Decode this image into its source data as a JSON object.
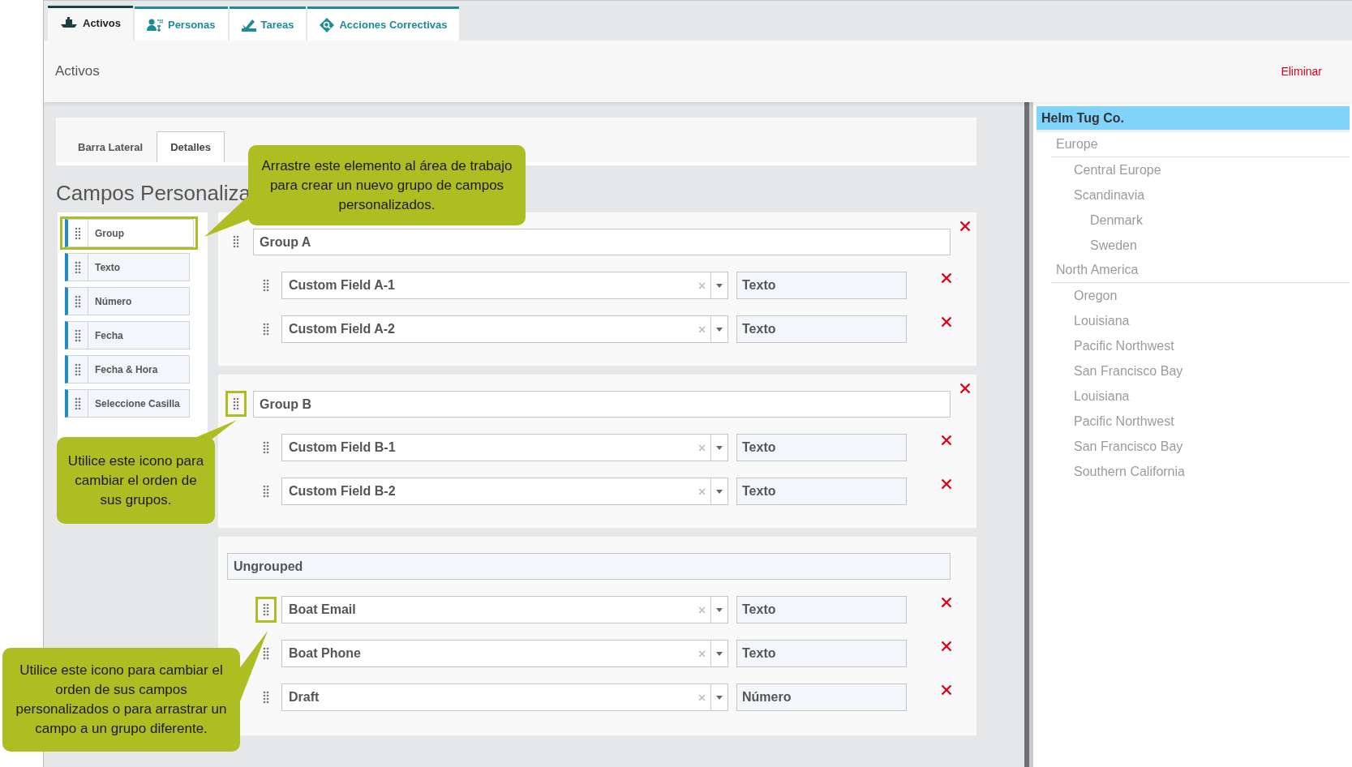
{
  "top_tabs": [
    {
      "label": "Activos",
      "selected": true
    },
    {
      "label": "Personas",
      "selected": false
    },
    {
      "label": "Tareas",
      "selected": false
    },
    {
      "label": "Acciones Correctivas",
      "selected": false
    }
  ],
  "header": {
    "title": "Activos",
    "action": "Eliminar"
  },
  "sub_tabs": [
    {
      "label": "Barra Lateral",
      "selected": false
    },
    {
      "label": "Detalles",
      "selected": true
    }
  ],
  "section_title": "Campos Personaliza",
  "palette": [
    {
      "label": "Group",
      "highlighted": true
    },
    {
      "label": "Texto",
      "highlighted": false
    },
    {
      "label": "Número",
      "highlighted": false
    },
    {
      "label": "Fecha",
      "highlighted": false
    },
    {
      "label": "Fecha & Hora",
      "highlighted": false
    },
    {
      "label": "Seleccione Casilla",
      "highlighted": false
    }
  ],
  "groups": [
    {
      "kind": "group",
      "name": "Group A",
      "highlighted": false,
      "fields": [
        {
          "name": "Custom Field A-1",
          "type": "Texto",
          "highlighted": false
        },
        {
          "name": "Custom Field A-2",
          "type": "Texto",
          "highlighted": false
        }
      ]
    },
    {
      "kind": "group",
      "name": "Group B",
      "highlighted": true,
      "fields": [
        {
          "name": "Custom Field B-1",
          "type": "Texto",
          "highlighted": false
        },
        {
          "name": "Custom Field B-2",
          "type": "Texto",
          "highlighted": false
        }
      ]
    },
    {
      "kind": "ungrouped",
      "name": "Ungrouped",
      "fields": [
        {
          "name": "Boat Email",
          "type": "Texto",
          "highlighted": true
        },
        {
          "name": "Boat Phone",
          "type": "Texto",
          "highlighted": false
        },
        {
          "name": "Draft",
          "type": "Número",
          "highlighted": false
        }
      ]
    }
  ],
  "tree": [
    {
      "label": "Helm Tug Co.",
      "selected": true,
      "children": [
        {
          "label": "Europe",
          "selected": false,
          "children": [
            {
              "label": "Central Europe",
              "selected": false
            },
            {
              "label": "Scandinavia",
              "selected": false,
              "children": [
                {
                  "label": "Denmark",
                  "selected": false
                },
                {
                  "label": "Sweden",
                  "selected": false
                }
              ]
            }
          ]
        },
        {
          "label": "North America",
          "selected": false,
          "children": [
            {
              "label": "Oregon",
              "selected": false
            },
            {
              "label": "Louisiana",
              "selected": false
            },
            {
              "label": "Pacific Northwest",
              "selected": false
            },
            {
              "label": "San Francisco Bay",
              "selected": false
            },
            {
              "label": "Louisiana",
              "selected": false
            },
            {
              "label": "Pacific Northwest",
              "selected": false
            },
            {
              "label": "San Francisco Bay",
              "selected": false
            },
            {
              "label": "Southern California",
              "selected": false
            }
          ]
        }
      ]
    }
  ],
  "callouts": [
    {
      "text": "Arrastre este elemento al área de trabajo para crear un nuevo grupo de campos personalizados."
    },
    {
      "text": "Utilice este icono para cambiar el orden de sus grupos."
    },
    {
      "text": "Utilice este icono para cambiar el orden de sus campos personalizados o para arrastrar un campo a un grupo diferente."
    }
  ]
}
